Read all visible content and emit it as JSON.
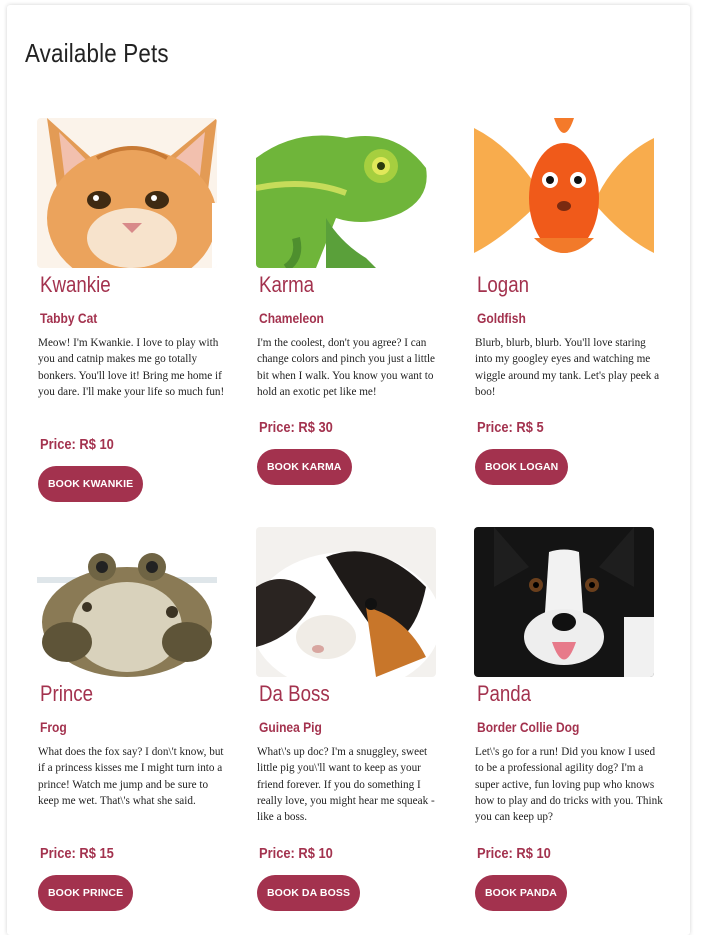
{
  "page": {
    "title": "Available Pets"
  },
  "pets": [
    {
      "name": "Kwankie",
      "breed": "Tabby Cat",
      "description": "Meow! I'm Kwankie. I love to play with you and catnip makes me go totally bonkers. You'll love it! Bring me home if you dare. I'll make your life so much fun!",
      "price_label": "Price: R$ 10",
      "button_label": "BOOK KWANKIE",
      "photo": "orange-kitten-photo"
    },
    {
      "name": "Karma",
      "breed": "Chameleon",
      "description": "I'm the coolest, don't you agree? I can change colors and pinch you just a little bit when I walk. You know you want to hold an exotic pet like me!",
      "price_label": "Price: R$ 30",
      "button_label": "BOOK KARMA",
      "photo": "green-chameleon-photo"
    },
    {
      "name": "Logan",
      "breed": "Goldfish",
      "description": "Blurb, blurb, blurb. You'll love staring into my googley eyes and watching me wiggle around my tank. Let's play peek a boo!",
      "price_label": "Price: R$ 5",
      "button_label": "BOOK LOGAN",
      "photo": "goldfish-photo"
    },
    {
      "name": "Prince",
      "breed": "Frog",
      "description": "What does the fox say? I don\\'t know, but if a princess kisses me I might turn into a prince! Watch me jump and be sure to keep me wet. That\\'s what she said.",
      "price_label": "Price: R$ 15",
      "button_label": "BOOK PRINCE",
      "photo": "frog-photo"
    },
    {
      "name": "Da Boss",
      "breed": "Guinea Pig",
      "description": "What\\'s up doc? I'm a snuggley, sweet little pig you\\'ll want to keep as your friend forever. If you do something I really love, you might hear me squeak - like a boss.",
      "price_label": "Price: R$ 10",
      "button_label": "BOOK DA BOSS",
      "photo": "guinea-pig-photo"
    },
    {
      "name": "Panda",
      "breed": "Border Collie Dog",
      "description": "Let\\'s go for a run! Did you know I used to be a professional agility dog? I'm a super active, fun loving pup who knows how to play and do tricks with you. Think you can keep up?",
      "price_label": "Price: R$ 10",
      "button_label": "BOOK PANDA",
      "photo": "border-collie-photo"
    }
  ],
  "theme": {
    "accent": "#a3324e",
    "text": "#222222",
    "background": "#ffffff"
  }
}
